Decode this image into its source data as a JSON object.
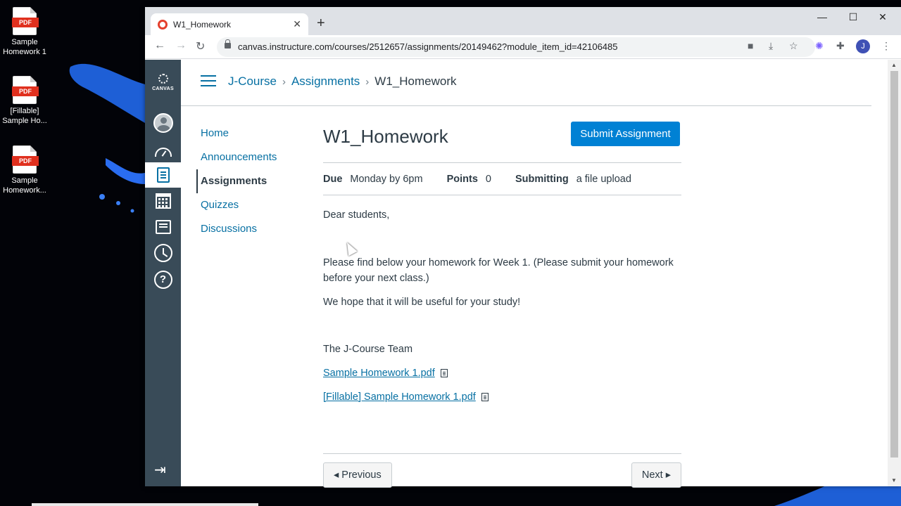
{
  "desktop": {
    "icons": [
      {
        "badge": "PDF",
        "label": "Sample Homework 1"
      },
      {
        "badge": "PDF",
        "label": "[Fillable] Sample Ho..."
      },
      {
        "badge": "PDF",
        "label": "Sample Homework..."
      }
    ]
  },
  "browser": {
    "tab_title": "W1_Homework",
    "tab_close": "✕",
    "new_tab": "+",
    "url": "canvas.instructure.com/courses/2512657/assignments/20149462?module_item_id=42106485",
    "profile_initial": "J",
    "window_controls": {
      "minimize": "—",
      "maximize": "☐",
      "close": "✕"
    }
  },
  "canvas": {
    "logo_text": "CANVAS",
    "breadcrumb": [
      "J-Course",
      "Assignments",
      "W1_Homework"
    ],
    "course_nav": [
      "Home",
      "Announcements",
      "Assignments",
      "Quizzes",
      "Discussions"
    ],
    "course_nav_active": "Assignments",
    "assignment": {
      "title": "W1_Homework",
      "submit_label": "Submit Assignment",
      "due_label": "Due",
      "due_value": "Monday by 6pm",
      "points_label": "Points",
      "points_value": "0",
      "submitting_label": "Submitting",
      "submitting_value": "a file upload",
      "greeting": "Dear students,",
      "paragraph1": "Please find below your homework for Week 1. (Please submit your homework before your next class.)",
      "paragraph2": "We hope that it will be useful for your study!",
      "signature": "The J-Course Team",
      "files": [
        "Sample Homework 1.pdf",
        "[Fillable] Sample Homework 1.pdf"
      ]
    },
    "pager": {
      "previous": "◂ Previous",
      "next": "Next ▸"
    },
    "help_glyph": "?",
    "collapse_glyph": "⇥"
  }
}
